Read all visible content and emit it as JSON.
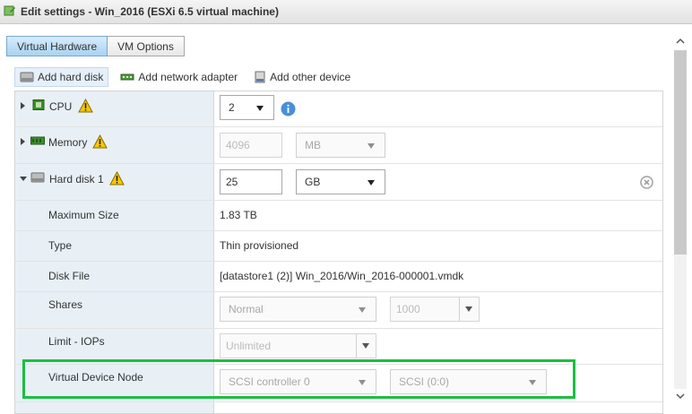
{
  "window": {
    "title": "Edit settings - Win_2016 (ESXi 6.5 virtual machine)",
    "accent_color": "#19c040"
  },
  "tabs": [
    {
      "label": "Virtual Hardware",
      "active": true
    },
    {
      "label": "VM Options",
      "active": false
    }
  ],
  "toolbar": {
    "add_hard_disk": "Add hard disk",
    "add_network_adapter": "Add network adapter",
    "add_other_device": "Add other device"
  },
  "cpu": {
    "label": "CPU",
    "value": "2",
    "icon": "cpu-chip-icon"
  },
  "memory": {
    "label": "Memory",
    "value": "4096",
    "unit": "MB",
    "icon": "memory-module-icon"
  },
  "hard_disk": {
    "label": "Hard disk 1",
    "size": "25",
    "unit": "GB",
    "icon": "hard-disk-icon",
    "max_size_label": "Maximum Size",
    "max_size_value": "1.83 TB",
    "type_label": "Type",
    "type_value": "Thin provisioned",
    "disk_file_label": "Disk File",
    "disk_file_value": "[datastore1 (2)] Win_2016/Win_2016-000001.vmdk",
    "shares_label": "Shares",
    "shares_value": "Normal",
    "shares_number": "1000",
    "limit_label": "Limit - IOPs",
    "limit_value": "Unlimited",
    "vdn_label": "Virtual Device Node",
    "vdn_controller": "SCSI controller 0",
    "vdn_slot": "SCSI (0:0)"
  }
}
